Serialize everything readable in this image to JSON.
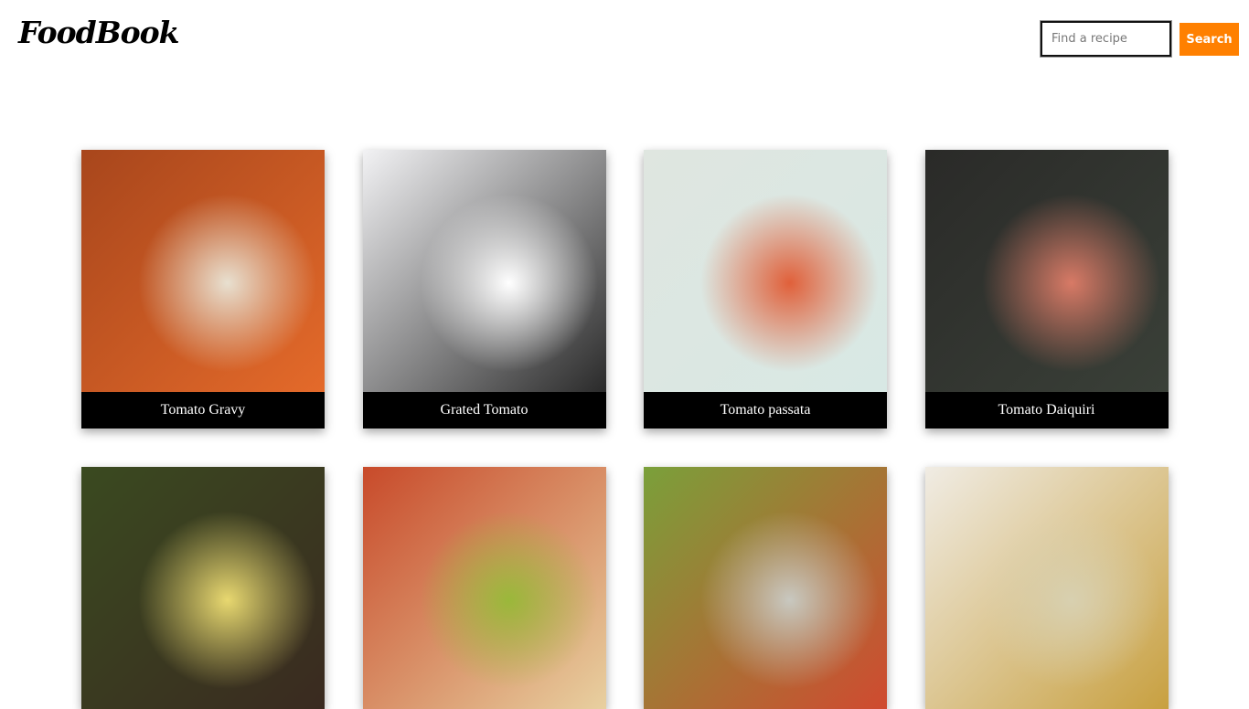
{
  "header": {
    "logo": "FoodBook",
    "search_placeholder": "Find a recipe",
    "search_button": "Search",
    "accent": "#ff8000"
  },
  "recipes": [
    {
      "title": "Tomato Gravy",
      "image_colors": [
        "#a8461c",
        "#e8e0d0",
        "#e46a2a"
      ]
    },
    {
      "title": "Grated Tomato",
      "image_colors": [
        "#f2f2f4",
        "#ffffff",
        "#2a2a2a"
      ]
    },
    {
      "title": "Tomato passata",
      "image_colors": [
        "#dfe6e0",
        "#e0603a",
        "#d8e8e4"
      ]
    },
    {
      "title": "Tomato Daiquiri",
      "image_colors": [
        "#2a2a28",
        "#d87a66",
        "#3a4038"
      ]
    },
    {
      "title": "",
      "image_colors": [
        "#3a4a20",
        "#e8d870",
        "#3a2a20"
      ]
    },
    {
      "title": "",
      "image_colors": [
        "#c84a2a",
        "#9ab83a",
        "#e8d0a0"
      ]
    },
    {
      "title": "",
      "image_colors": [
        "#7aa03a",
        "#c8c8c0",
        "#d04a30"
      ]
    },
    {
      "title": "",
      "image_colors": [
        "#f0ece4",
        "#d8d0b0",
        "#c8a040"
      ]
    }
  ]
}
